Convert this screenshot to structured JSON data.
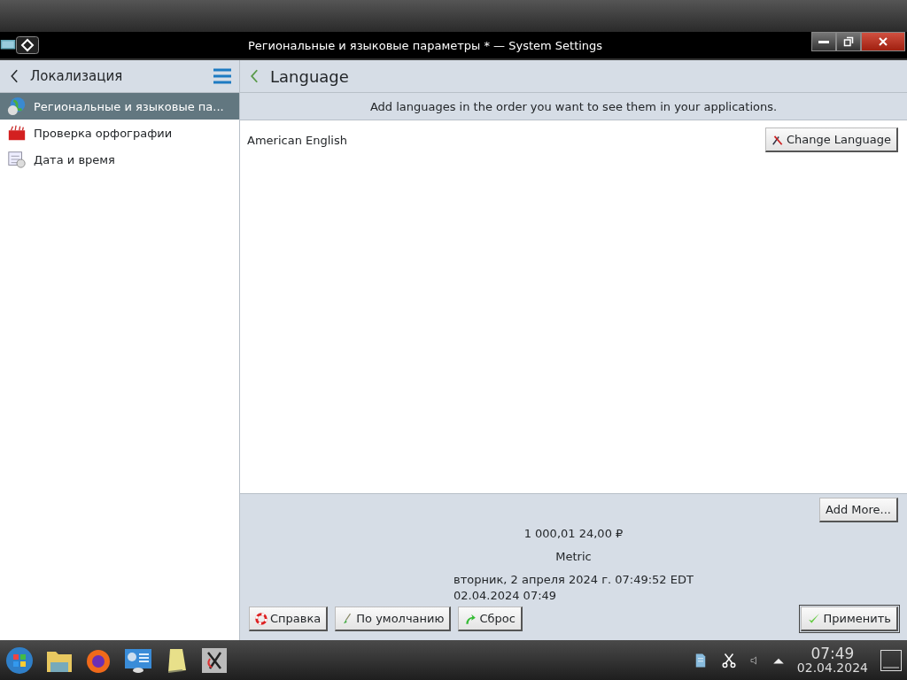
{
  "window": {
    "title": "Региональные и языковые параметры * — System Settings"
  },
  "sidebar": {
    "title": "Локализация",
    "items": [
      {
        "label": "Региональные и языковые па...",
        "selected": true
      },
      {
        "label": "Проверка орфографии",
        "selected": false
      },
      {
        "label": "Дата и время",
        "selected": false
      }
    ]
  },
  "page": {
    "title": "Language",
    "hint": "Add languages in the order you want to see them in your applications.",
    "languages": [
      {
        "name": "American English",
        "button": "Change Language"
      }
    ],
    "add_button": "Add More...",
    "preview": [
      "1 000,01  24,00 ₽",
      "Metric",
      "вторник, 2 апреля 2024 г. 07:49:52 EDT\n02.04.2024 07:49"
    ]
  },
  "buttons": [
    {
      "label": "Справка",
      "kind": "help"
    },
    {
      "label": "По умолчанию",
      "kind": "defaults"
    },
    {
      "label": "Сброс",
      "kind": "reset"
    },
    {
      "label": "Применить",
      "kind": "apply"
    }
  ],
  "taskbar": {
    "time": "07:49",
    "date": "02.04.2024"
  }
}
